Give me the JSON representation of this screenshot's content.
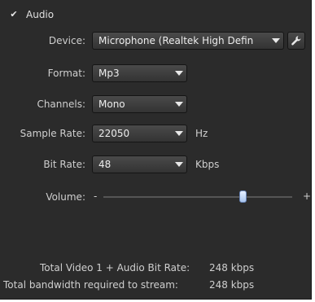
{
  "audio": {
    "enabled_label": "Audio",
    "check_glyph": "✔"
  },
  "device": {
    "label": "Device:",
    "value": "Microphone (Realtek High Defin"
  },
  "format": {
    "label": "Format:",
    "value": "Mp3"
  },
  "channels": {
    "label": "Channels:",
    "value": "Mono"
  },
  "sample_rate": {
    "label": "Sample Rate:",
    "value": "22050",
    "unit": "Hz"
  },
  "bit_rate": {
    "label": "Bit Rate:",
    "value": "48",
    "unit": "Kbps"
  },
  "volume": {
    "label": "Volume:",
    "minus": "-",
    "plus": "+",
    "level_fraction": 0.74
  },
  "summary": {
    "total_label": "Total Video 1 + Audio Bit Rate:",
    "total_value": "248 kbps",
    "bandwidth_label": "Total bandwidth required to stream:",
    "bandwidth_value": "248 kbps"
  },
  "icons": {
    "settings": "wrench-icon",
    "dropdown": "triangle-down"
  },
  "colors": {
    "panel_bg": "#2b2b2b",
    "slider_thumb": "#a8c4ee"
  }
}
